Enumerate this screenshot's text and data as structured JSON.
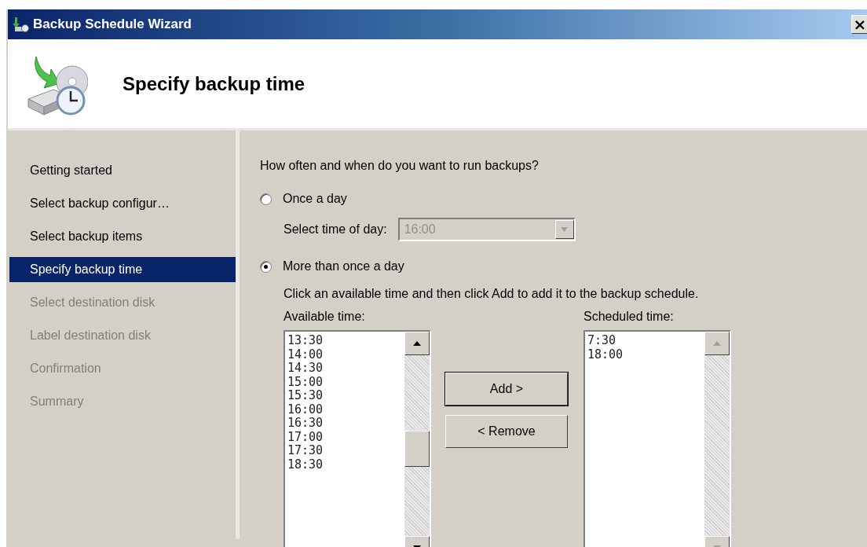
{
  "window": {
    "title": "Backup Schedule Wizard",
    "close": "×"
  },
  "header": {
    "title": "Specify backup time"
  },
  "steps": [
    {
      "label": "Getting started",
      "selected": false,
      "disabled": false
    },
    {
      "label": "Select backup configur…",
      "selected": false,
      "disabled": false
    },
    {
      "label": "Select backup items",
      "selected": false,
      "disabled": false
    },
    {
      "label": "Specify backup time",
      "selected": true,
      "disabled": false
    },
    {
      "label": "Select destination disk",
      "selected": false,
      "disabled": true
    },
    {
      "label": "Label destination disk",
      "selected": false,
      "disabled": true
    },
    {
      "label": "Confirmation",
      "selected": false,
      "disabled": true
    },
    {
      "label": "Summary",
      "selected": false,
      "disabled": true
    }
  ],
  "question": "How often and when do you want to run backups?",
  "options": [
    {
      "label": "Once a day",
      "selected": false
    },
    {
      "label": "More than once a day",
      "selected": true
    }
  ],
  "time_of_day": {
    "label": "Select time of day:",
    "value": "16:00",
    "disabled": true
  },
  "instruction": "Click an available time and then click Add to add it to the backup schedule.",
  "available": {
    "label": "Available time:",
    "items": [
      "13:30",
      "14:00",
      "14:30",
      "15:00",
      "15:30",
      "16:00",
      "16:30",
      "17:00",
      "17:30",
      "18:30"
    ],
    "disabled": false
  },
  "scheduled": {
    "label": "Scheduled time:",
    "items": [
      "7:30",
      "18:00"
    ],
    "disabled": true
  },
  "buttons": [
    {
      "label": "Add >",
      "default": true
    },
    {
      "label": "< Remove",
      "default": false
    }
  ]
}
